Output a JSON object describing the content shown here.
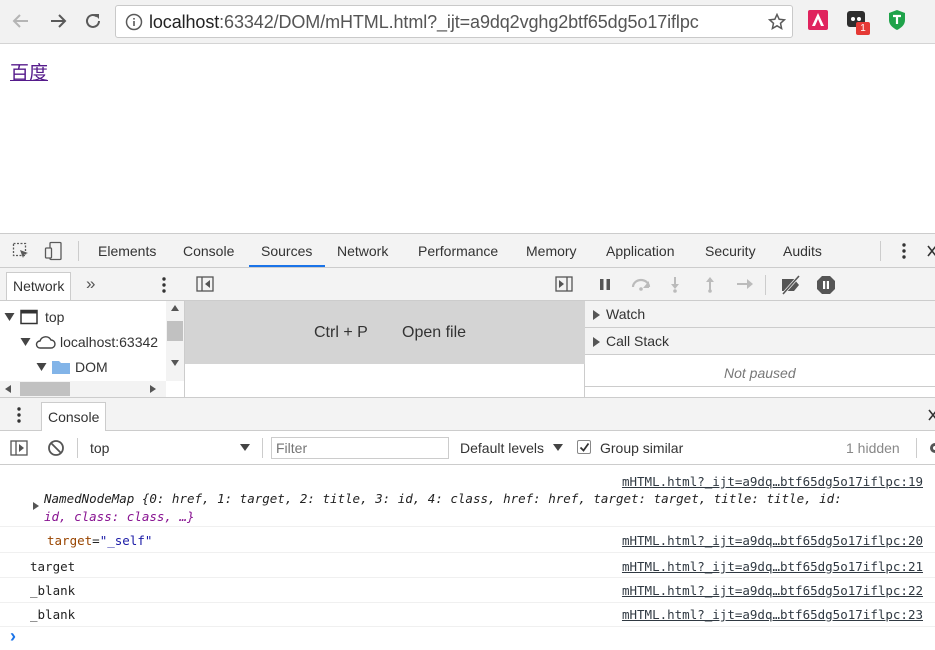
{
  "browser": {
    "url_host": "localhost",
    "url_rest": ":63342/DOM/mHTML.html?_ijt=a9dq2vghg2btf65dg5o17iflpc",
    "extension_badge": "1"
  },
  "page": {
    "link_text": "百度"
  },
  "devtools": {
    "tabs": [
      "Elements",
      "Console",
      "Sources",
      "Network",
      "Performance",
      "Memory",
      "Application",
      "Security",
      "Audits"
    ],
    "active_tab": "Sources",
    "navigator": {
      "tab_label": "Network",
      "more_label": "»",
      "tree": [
        {
          "label": "top",
          "icon": "frame-icon"
        },
        {
          "label": "localhost:63342",
          "icon": "cloud-icon"
        },
        {
          "label": "DOM",
          "icon": "folder-icon"
        }
      ]
    },
    "editor": {
      "shortcut": "Ctrl + P",
      "hint": "Open file"
    },
    "debugger": {
      "sections": [
        "Watch",
        "Call Stack"
      ],
      "call_stack_status": "Not paused"
    },
    "drawer": {
      "tab_label": "Console"
    },
    "console_toolbar": {
      "context": "top",
      "filter_placeholder": "Filter",
      "levels": "Default levels",
      "group_similar": "Group similar",
      "group_similar_checked": true,
      "hidden_count": "1 hidden"
    },
    "messages": [
      {
        "source": "mHTML.html?_ijt=a9dq…btf65dg5o17iflpc:19",
        "line1": "NamedNodeMap {0: href, 1: target, 2: title, 3: id, 4: class, href: href, target: target, title: title, id:",
        "line2": "id, class: class, …}"
      },
      {
        "source": "mHTML.html?_ijt=a9dq…btf65dg5o17iflpc:20",
        "attr_name": "target",
        "attr_value": "\"_self\""
      },
      {
        "source": "mHTML.html?_ijt=a9dq…btf65dg5o17iflpc:21",
        "text": "target"
      },
      {
        "source": "mHTML.html?_ijt=a9dq…btf65dg5o17iflpc:22",
        "text": "_blank"
      },
      {
        "source": "mHTML.html?_ijt=a9dq…btf65dg5o17iflpc:23",
        "text": "_blank"
      }
    ],
    "prompt_symbol": "›"
  }
}
